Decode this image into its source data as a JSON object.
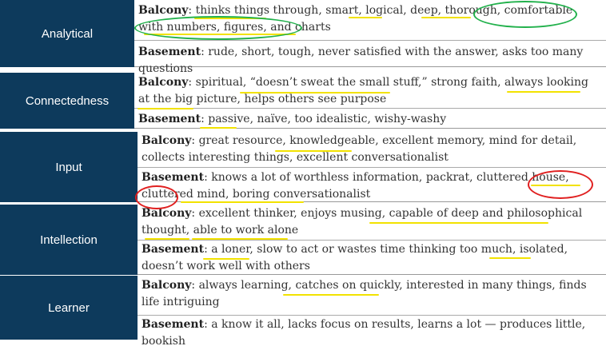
{
  "rows": [
    {
      "theme": "Analytical",
      "balcony": {
        "key": "Balcony",
        "text": ": thinks things through, smart, logical, deep, thorough, comfortable with numbers, figures, and charts"
      },
      "basement": {
        "key": "Basement",
        "text": ": rude, short, tough, never satisfied with the answer, asks too many questions"
      }
    },
    {
      "theme": "Connectedness",
      "balcony": {
        "key": "Balcony",
        "text": ": spiritual, “doesn’t sweat the small stuff,” strong faith, always looking at the big picture, helps others see purpose"
      },
      "basement": {
        "key": "Basement",
        "text": ": passive, naïve, too idealistic, wishy-washy"
      }
    },
    {
      "theme": "Input",
      "balcony": {
        "key": "Balcony",
        "text": ": great resource, knowledgeable, excellent memory, mind for detail, collects interesting things, excellent conversationalist"
      },
      "basement": {
        "key": "Basement",
        "text": ": knows a lot of worthless information, packrat, cluttered house, cluttered mind, boring conversationalist"
      }
    },
    {
      "theme": "Intellection",
      "balcony": {
        "key": "Balcony",
        "text": ": excellent thinker, enjoys musing, capable of deep and philosophical thought, able to work alone"
      },
      "basement": {
        "key": "Basement",
        "text": ": a loner, slow to act or wastes time thinking too much, isolated, doesn’t work well with others"
      }
    },
    {
      "theme": "Learner",
      "balcony": {
        "key": "Balcony",
        "text": ": always learning, catches on quickly, interested in many things, finds life intriguing"
      },
      "basement": {
        "key": "Basement",
        "text": ": a know it all, lacks focus on results, learns a lot — produces little, bookish"
      }
    }
  ],
  "colors": {
    "label_bg": "#0d3a5c",
    "highlight": "#f2e200",
    "green_circle": "#22b14c",
    "red_circle": "#e02020"
  }
}
